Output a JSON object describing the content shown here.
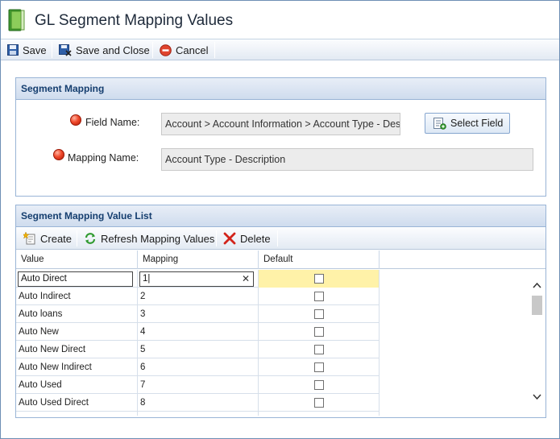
{
  "window": {
    "title": "GL Segment Mapping Values"
  },
  "toolbar": {
    "save_label": "Save",
    "save_close_label": "Save and Close",
    "cancel_label": "Cancel"
  },
  "segment_mapping": {
    "header": "Segment Mapping",
    "field_name_label": "Field Name:",
    "field_name_value": "Account > Account Information > Account Type - Description",
    "select_field_label": "Select Field",
    "mapping_name_label": "Mapping Name:",
    "mapping_name_value": "Account Type - Description"
  },
  "value_list": {
    "header": "Segment Mapping Value List",
    "create_label": "Create",
    "refresh_label": "Refresh Mapping Values",
    "delete_label": "Delete",
    "columns": [
      "Value",
      "Mapping",
      "Default"
    ],
    "edit_row": {
      "value": "Auto Direct",
      "mapping": "1",
      "default": false
    },
    "rows": [
      {
        "value": "Auto Indirect",
        "mapping": "2",
        "default": false
      },
      {
        "value": "Auto loans",
        "mapping": "3",
        "default": false
      },
      {
        "value": "Auto New",
        "mapping": "4",
        "default": false
      },
      {
        "value": "Auto New Direct",
        "mapping": "5",
        "default": false
      },
      {
        "value": "Auto New Indirect",
        "mapping": "6",
        "default": false
      },
      {
        "value": "Auto Used",
        "mapping": "7",
        "default": false
      },
      {
        "value": "Auto Used Direct",
        "mapping": "8",
        "default": false
      }
    ]
  },
  "colors": {
    "header_text": "#153e6f",
    "edit_row_highlight": "#fff2a8",
    "required_dot": "#f04a2c"
  }
}
